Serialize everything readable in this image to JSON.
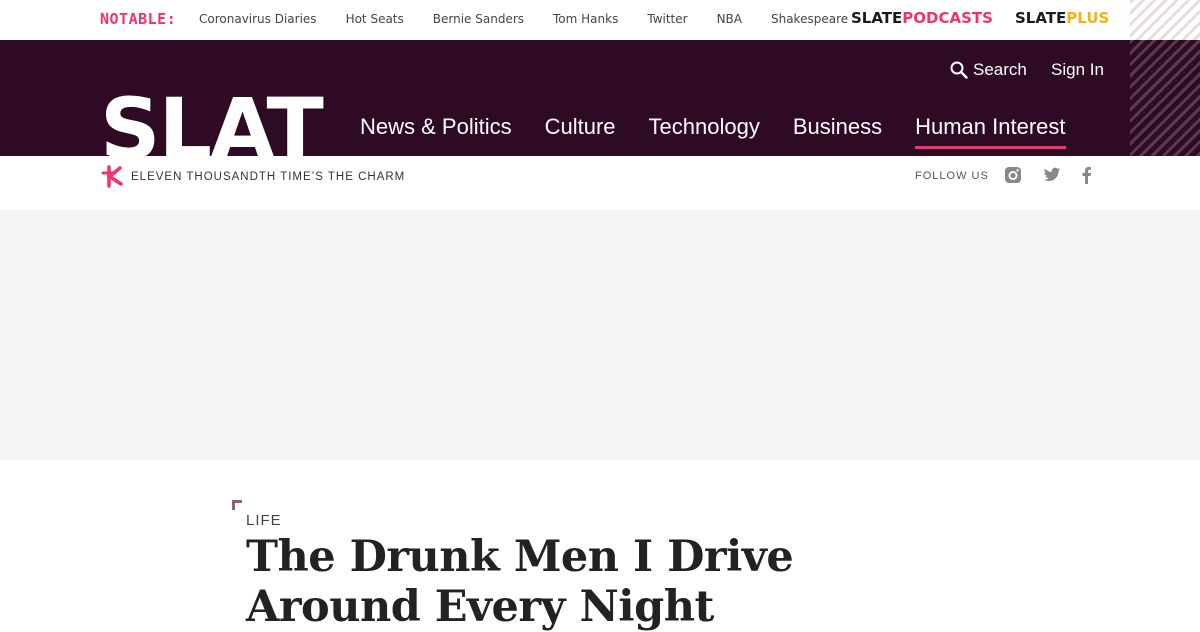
{
  "notable": {
    "label": "NOTABLE:",
    "links": [
      "Coronavirus Diaries",
      "Hot Seats",
      "Bernie Sanders",
      "Tom Hanks",
      "Twitter",
      "NBA",
      "Shakespeare"
    ]
  },
  "brands": {
    "podcasts": {
      "prefix": "SLATE",
      "suffix": "PODCASTS"
    },
    "plus": {
      "prefix": "SLATE",
      "suffix": "PLUS"
    }
  },
  "header": {
    "logo_text": "SLATE",
    "search_label": "Search",
    "signin_label": "Sign In",
    "nav": [
      {
        "label": "News & Politics",
        "active": false
      },
      {
        "label": "Culture",
        "active": false
      },
      {
        "label": "Technology",
        "active": false
      },
      {
        "label": "Business",
        "active": false
      },
      {
        "label": "Human Interest",
        "active": true
      }
    ]
  },
  "tagline": {
    "text": "Eleven thousandth time’s the charm",
    "follow_label": "FOLLOW US",
    "social_icons": [
      "instagram-icon",
      "twitter-icon",
      "facebook-icon"
    ]
  },
  "article": {
    "section": "LIFE",
    "headline": "The Drunk Men I Drive Around Every Night"
  },
  "colors": {
    "header_bg": "#2e0a24",
    "accent_pink": "#f1336b",
    "plus_yellow": "#f5b20a",
    "ad_bg": "#f5f5f5"
  }
}
